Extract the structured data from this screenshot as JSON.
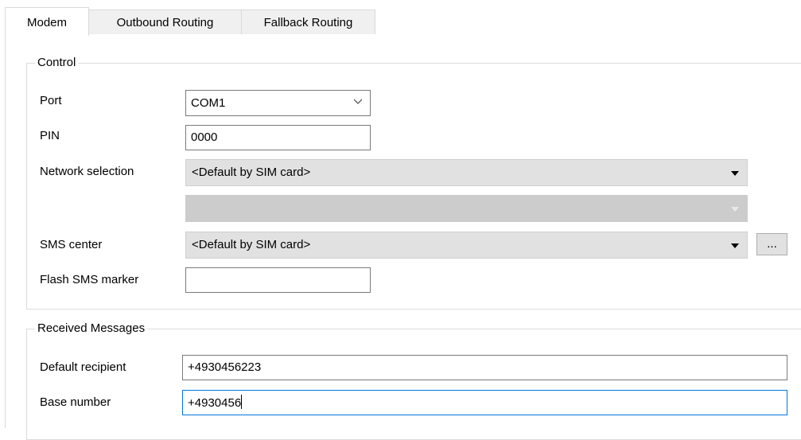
{
  "tabs": [
    {
      "label": "Modem",
      "active": true
    },
    {
      "label": "Outbound Routing",
      "active": false
    },
    {
      "label": "Fallback Routing",
      "active": false
    }
  ],
  "control": {
    "title": "Control",
    "port": {
      "label": "Port",
      "value": "COM1",
      "icon": "chevron-down-icon"
    },
    "pin": {
      "label": "PIN",
      "value": "0000"
    },
    "network": {
      "label": "Network selection",
      "value": "<Default by SIM card>",
      "secondary_value": ""
    },
    "sms_center": {
      "label": "SMS center",
      "value": "<Default by SIM card>",
      "browse_label": "..."
    },
    "flash": {
      "label": "Flash SMS marker",
      "value": ""
    }
  },
  "received": {
    "title": "Received Messages",
    "default_recipient": {
      "label": "Default recipient",
      "value": "+4930456223"
    },
    "base_number": {
      "label": "Base number",
      "value": "+4930456"
    }
  },
  "colors": {
    "focus_border": "#0078d7",
    "dropdown_bg": "#e1e1e1",
    "disabled_bg": "#cccccc"
  }
}
